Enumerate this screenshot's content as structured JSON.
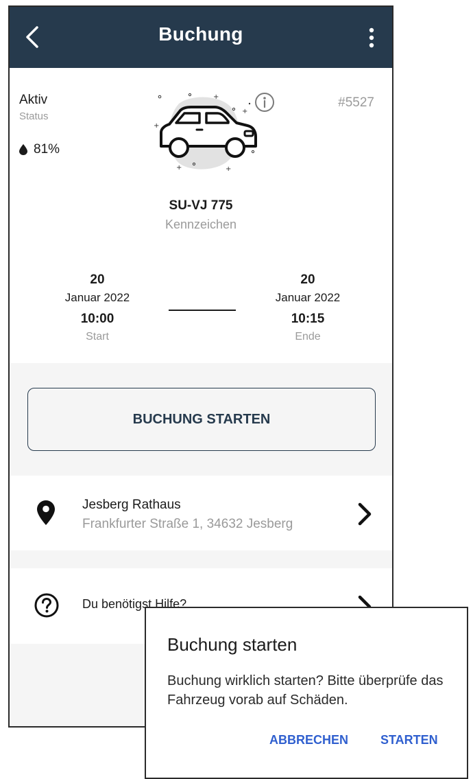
{
  "header": {
    "title": "Buchung",
    "back_icon": "chevron-left-icon",
    "menu_icon": "more-vertical-icon"
  },
  "vehicle": {
    "status": "Aktiv",
    "status_label": "Status",
    "fuel": "81%",
    "booking_id": "#5527",
    "plate": "SU-VJ 775",
    "plate_label": "Kennzeichen"
  },
  "period": {
    "start": {
      "day": "20",
      "month": "Januar 2022",
      "time": "10:00",
      "label": "Start"
    },
    "end": {
      "day": "20",
      "month": "Januar 2022",
      "time": "10:15",
      "label": "Ende"
    }
  },
  "actions": {
    "start_button": "BUCHUNG STARTEN"
  },
  "location": {
    "name": "Jesberg Rathaus",
    "address": "Frankfurter Straße 1, 34632 Jesberg"
  },
  "help": {
    "label": "Du benötigst Hilfe?"
  },
  "dialog": {
    "title": "Buchung starten",
    "message": "Buchung wirklich starten? Bitte überprüfe das Fahrzeug vorab auf Schäden.",
    "cancel": "ABBRECHEN",
    "confirm": "STARTEN"
  },
  "colors": {
    "header_bg": "#263a4d",
    "accent": "#2f5fcf",
    "muted_text": "#9a9a9a",
    "section_bg": "#f5f5f5"
  }
}
